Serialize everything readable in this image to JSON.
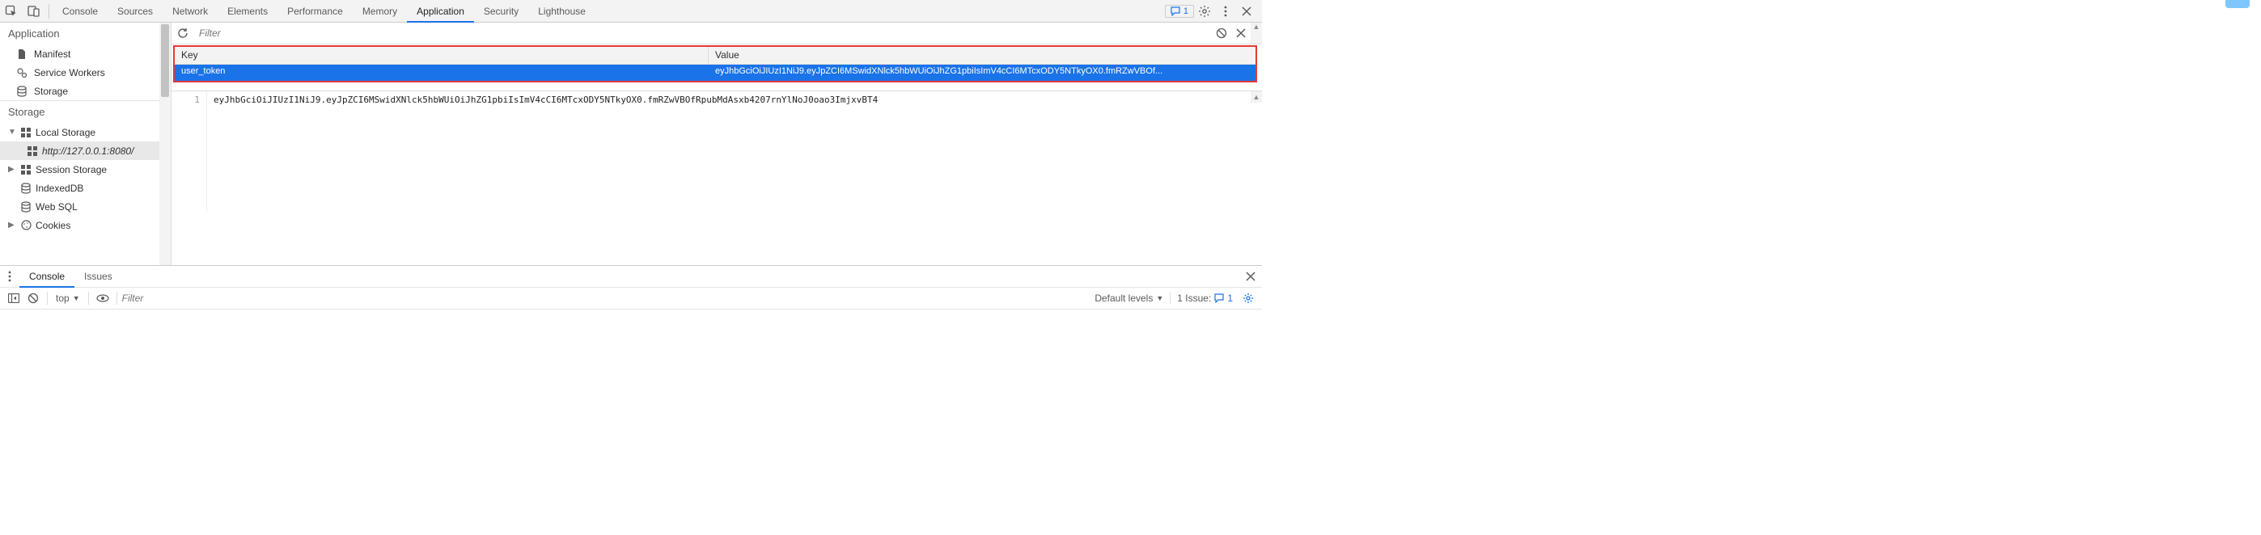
{
  "tabs": {
    "console": "Console",
    "sources": "Sources",
    "network": "Network",
    "elements": "Elements",
    "performance": "Performance",
    "memory": "Memory",
    "application": "Application",
    "security": "Security",
    "lighthouse": "Lighthouse"
  },
  "top_right": {
    "message_count": "1"
  },
  "sidebar": {
    "application_header": "Application",
    "app_items": {
      "manifest": "Manifest",
      "service_workers": "Service Workers",
      "storage": "Storage"
    },
    "storage_header": "Storage",
    "storage_items": {
      "local_storage": "Local Storage",
      "local_storage_origin": "http://127.0.0.1:8080/",
      "session_storage": "Session Storage",
      "indexeddb": "IndexedDB",
      "web_sql": "Web SQL",
      "cookies": "Cookies"
    }
  },
  "filter": {
    "placeholder": "Filter"
  },
  "table": {
    "key_header": "Key",
    "value_header": "Value",
    "row": {
      "key": "user_token",
      "value": "eyJhbGciOiJIUzI1NiJ9.eyJpZCI6MSwidXNlck5hbWUiOiJhZG1pbiIsImV4cCI6MTcxODY5NTkyOX0.fmRZwVBOf..."
    }
  },
  "detail": {
    "line_number": "1",
    "value": "eyJhbGciOiJIUzI1NiJ9.eyJpZCI6MSwidXNlck5hbWUiOiJhZG1pbiIsImV4cCI6MTcxODY5NTkyOX0.fmRZwVBOfRpubMdAsxb4207rnYlNoJ0oao3ImjxvBT4"
  },
  "drawer": {
    "tabs": {
      "console": "Console",
      "issues": "Issues"
    },
    "context": "top",
    "filter_placeholder": "Filter",
    "levels": "Default levels",
    "issue_label": "1 Issue:",
    "issue_count": "1"
  }
}
